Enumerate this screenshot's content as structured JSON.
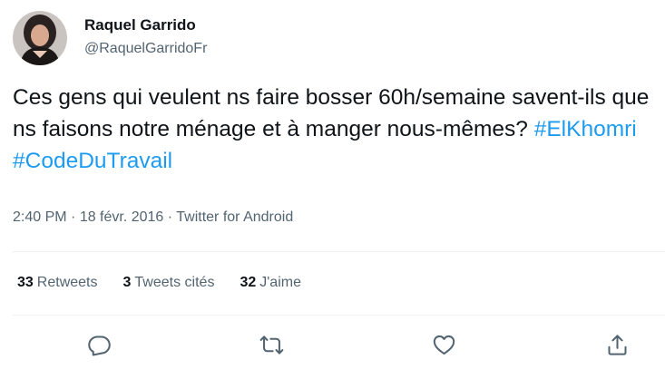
{
  "author": {
    "display_name": "Raquel Garrido",
    "handle": "@RaquelGarridoFr"
  },
  "tweet": {
    "text_plain": "Ces gens qui veulent ns faire bosser 60h/semaine savent-ils que ns faisons notre ménage et à manger nous-mêmes? ",
    "hashtag_1": "#ElKhomri",
    "hashtag_2": "#CodeDuTravail"
  },
  "meta": {
    "time": "2:40 PM",
    "date": "18 févr. 2016",
    "source": "Twitter for Android"
  },
  "stats": {
    "retweets_count": "33",
    "retweets_label": "Retweets",
    "quotes_count": "3",
    "quotes_label": "Tweets cités",
    "likes_count": "32",
    "likes_label": "J'aime"
  },
  "colors": {
    "text": "#0f1419",
    "secondary": "#536471",
    "link": "#1d9bf0",
    "divider": "#eff3f4"
  },
  "icons": [
    "reply-icon",
    "retweet-icon",
    "like-icon",
    "share-icon"
  ]
}
